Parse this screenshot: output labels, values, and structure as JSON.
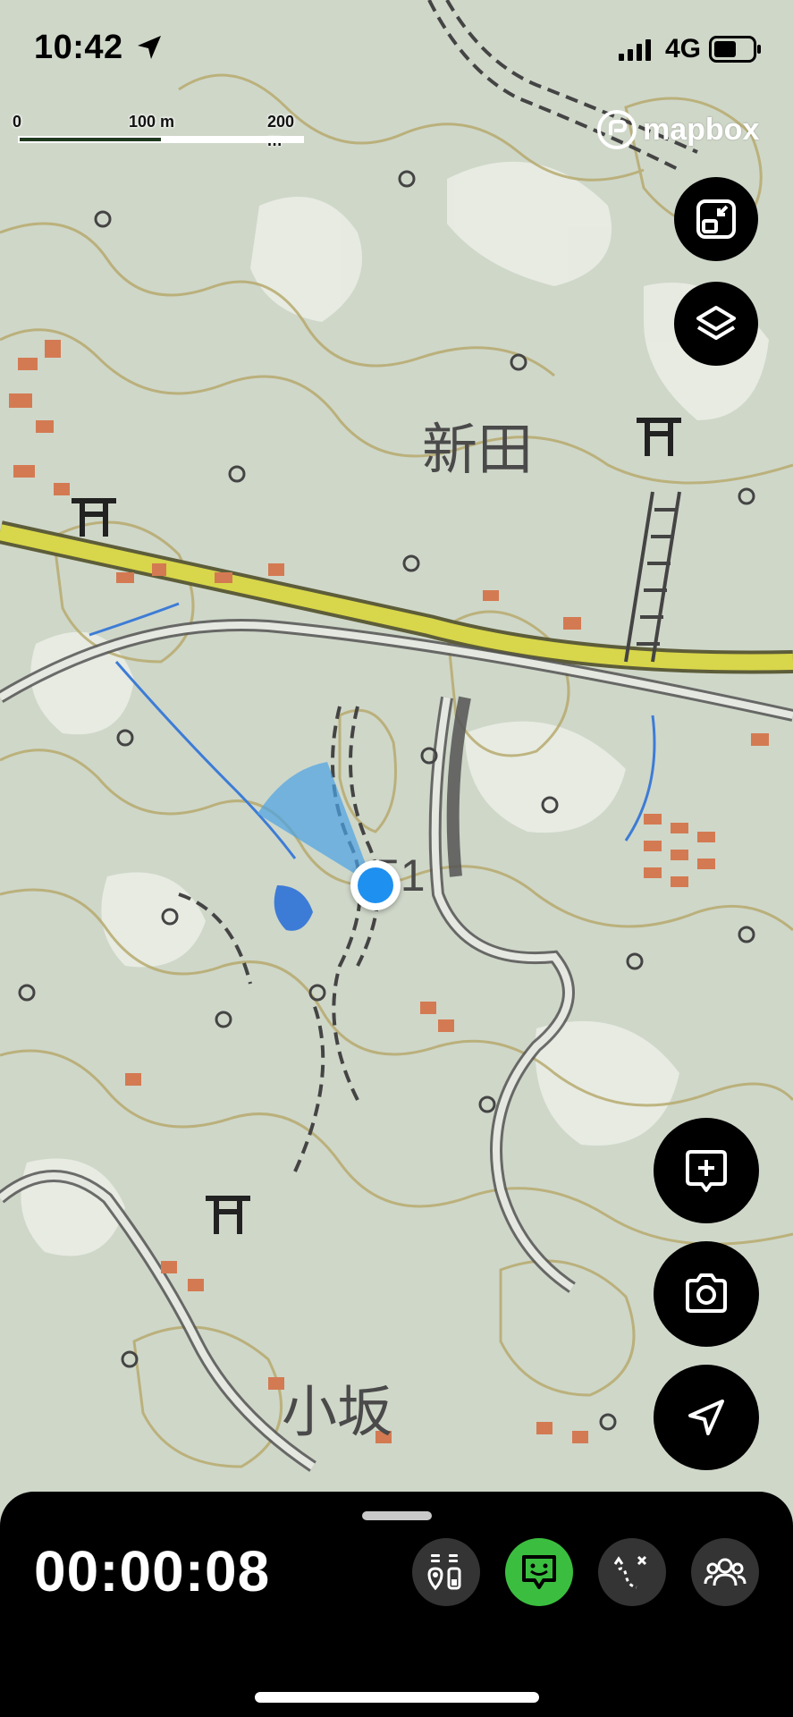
{
  "status_bar": {
    "time": "10:42",
    "network": "4G"
  },
  "map": {
    "scale": {
      "labels": [
        "0",
        "100 m",
        "200 m"
      ]
    },
    "attribution": "mapbox",
    "place_labels": [
      "新田",
      "小坂"
    ],
    "elevation_label": "51"
  },
  "controls": {
    "right_top": [
      "fullscreen-toggle-icon",
      "layers-icon"
    ],
    "right_bottom": [
      "add-note-icon",
      "camera-icon",
      "navigate-icon"
    ]
  },
  "bottom_panel": {
    "timer": "00:00:08",
    "buttons": [
      "stats-icon",
      "chat-icon",
      "route-icon",
      "group-icon"
    ],
    "active_button": "chat-icon",
    "colors": {
      "active": "#3bbe3f",
      "inactive": "#343434"
    }
  }
}
